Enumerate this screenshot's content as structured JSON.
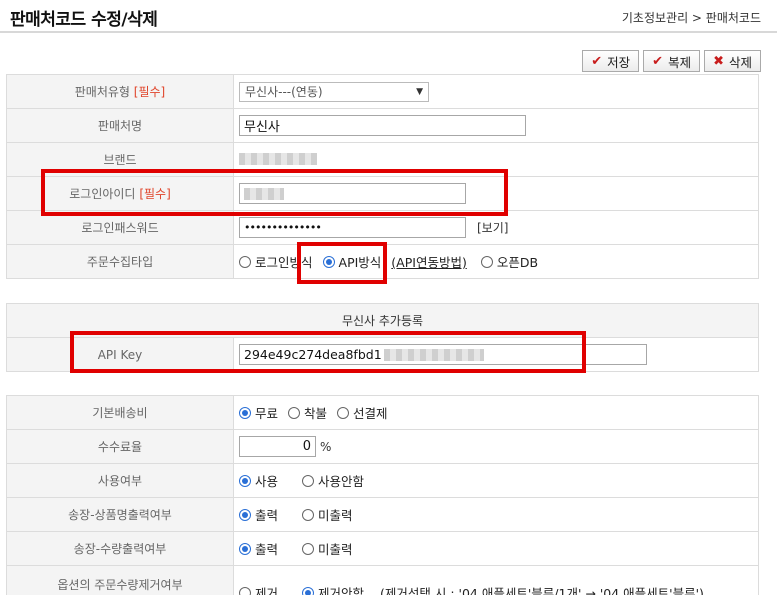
{
  "header": {
    "title": "판매처코드 수정/삭제",
    "breadcrumb": "기초정보관리 > 판매처코드"
  },
  "toolbar": {
    "save_label": "저장",
    "copy_label": "복제",
    "delete_label": "삭제"
  },
  "form": {
    "vendor_type": {
      "label": "판매처유형",
      "required": "[필수]",
      "value": "무신사---(연동)"
    },
    "vendor_name": {
      "label": "판매처명",
      "value": "무신사"
    },
    "brand": {
      "label": "브랜드"
    },
    "login_id": {
      "label": "로그인아이디",
      "required": "[필수]"
    },
    "login_password": {
      "label": "로그인패스워드",
      "value": "••••••••••••••",
      "view_label": "[보기]"
    },
    "order_collect_type": {
      "label": "주문수집타입",
      "options": [
        "로그인방식",
        "API방식",
        "오픈DB"
      ],
      "selected": "API방식",
      "api_link": "(API연동방법)"
    }
  },
  "extra_section": {
    "title": "무신사 추가등록",
    "api_key": {
      "label": "API Key",
      "value": "294e49c274dea8fbd1"
    }
  },
  "settings": {
    "shipping_fee": {
      "label": "기본배송비",
      "options": [
        "무료",
        "착불",
        "선결제"
      ],
      "selected": "무료"
    },
    "commission": {
      "label": "수수료율",
      "value": "0",
      "unit": "%"
    },
    "in_use": {
      "label": "사용여부",
      "options": [
        "사용",
        "사용안함"
      ],
      "selected": "사용"
    },
    "invoice_product_print": {
      "label": "송장-상품명출력여부",
      "options": [
        "출력",
        "미출력"
      ],
      "selected": "출력"
    },
    "invoice_qty_print": {
      "label": "송장-수량출력여부",
      "options": [
        "출력",
        "미출력"
      ],
      "selected": "출력"
    },
    "option_qty_remove": {
      "label": "옵션의 주문수량제거여부",
      "options": [
        "제거",
        "제거안함"
      ],
      "selected": "제거안함",
      "note": "(제거선택 시 : '04 애플세트'블루/1개' → '04 애플세트'블루')"
    }
  },
  "colors": {
    "highlight": "#e00000",
    "radio_on": "#2a6fd6",
    "required": "#e0442a"
  }
}
